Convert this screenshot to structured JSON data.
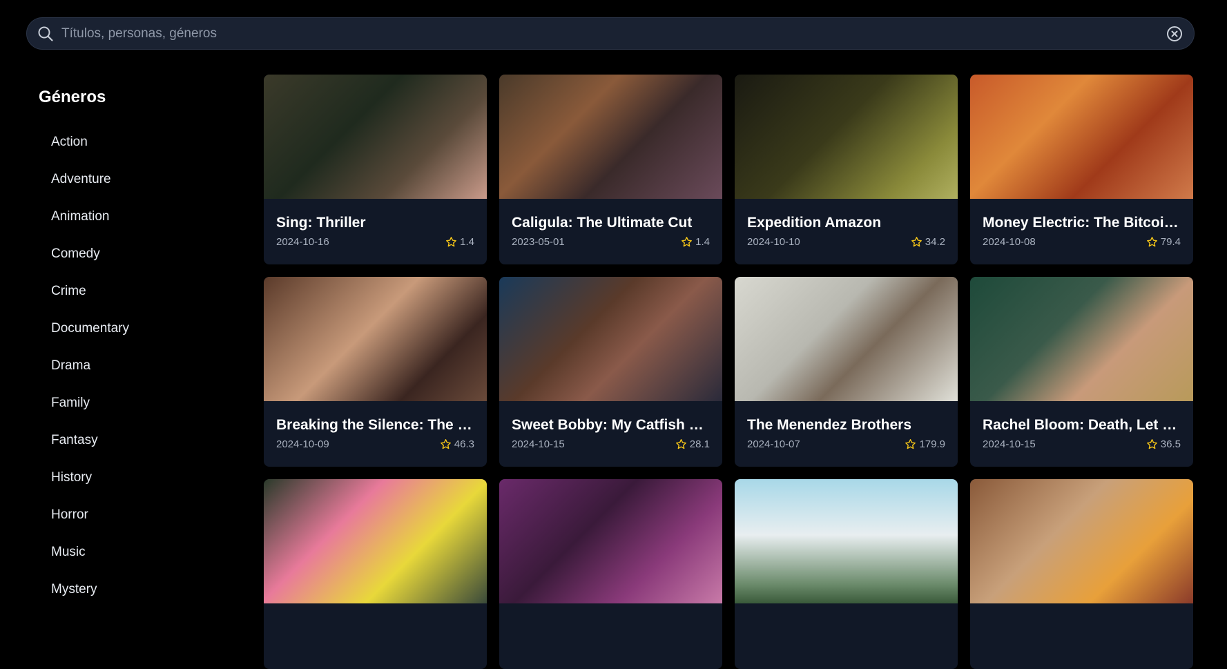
{
  "search": {
    "placeholder": "Títulos, personas, géneros"
  },
  "sidebar": {
    "title": "Géneros",
    "genres": [
      "Action",
      "Adventure",
      "Animation",
      "Comedy",
      "Crime",
      "Documentary",
      "Drama",
      "Family",
      "Fantasy",
      "History",
      "Horror",
      "Music",
      "Mystery"
    ]
  },
  "movies": [
    {
      "title": "Sing: Thriller",
      "date": "2024-10-16",
      "rating": "1.4"
    },
    {
      "title": "Caligula: The Ultimate Cut",
      "date": "2023-05-01",
      "rating": "1.4"
    },
    {
      "title": "Expedition Amazon",
      "date": "2024-10-10",
      "rating": "34.2"
    },
    {
      "title": "Money Electric: The Bitcoin ...",
      "date": "2024-10-08",
      "rating": "79.4"
    },
    {
      "title": "Breaking the Silence: The M...",
      "date": "2024-10-09",
      "rating": "46.3"
    },
    {
      "title": "Sweet Bobby: My Catfish Ni...",
      "date": "2024-10-15",
      "rating": "28.1"
    },
    {
      "title": "The Menendez Brothers",
      "date": "2024-10-07",
      "rating": "179.9"
    },
    {
      "title": "Rachel Bloom: Death, Let M...",
      "date": "2024-10-15",
      "rating": "36.5"
    },
    {
      "title": "",
      "date": "",
      "rating": ""
    },
    {
      "title": "",
      "date": "",
      "rating": ""
    },
    {
      "title": "",
      "date": "",
      "rating": ""
    },
    {
      "title": "",
      "date": "",
      "rating": ""
    }
  ],
  "colors": {
    "background": "#000000",
    "search_bg": "#1a2232",
    "card_bg": "#111827",
    "star": "#f5c518",
    "muted_text": "#aab2c0"
  },
  "icons": {
    "search": "search-icon",
    "clear": "clear-circle-x-icon",
    "rating": "star-outline-icon"
  }
}
